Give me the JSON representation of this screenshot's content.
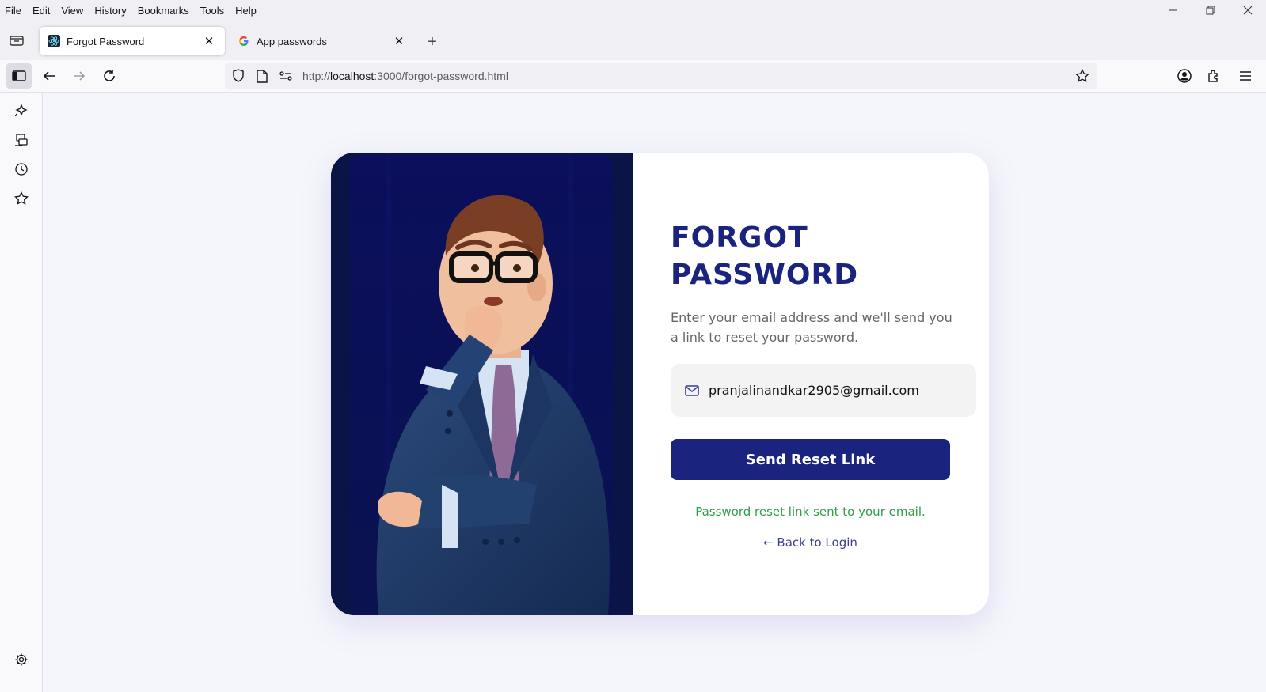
{
  "menu": [
    "File",
    "Edit",
    "View",
    "History",
    "Bookmarks",
    "Tools",
    "Help"
  ],
  "tabs": [
    {
      "title": "Forgot Password",
      "active": true
    },
    {
      "title": "App passwords",
      "active": false
    }
  ],
  "url": {
    "prefix": "http://",
    "host": "localhost",
    "rest": ":3000/forgot-password.html"
  },
  "page": {
    "heading": "FORGOT PASSWORD",
    "subtext": "Enter your email address and we'll send you a link to reset your password.",
    "email_value": "pranjalinandkar2905@gmail.com",
    "button_label": "Send Reset Link",
    "success_message": "Password reset link sent to your email.",
    "back_link": "← Back to Login"
  },
  "colors": {
    "accent": "#1a237e",
    "success": "#2e9e48",
    "link": "#3f3d96",
    "art_bg": "#0b1446"
  }
}
